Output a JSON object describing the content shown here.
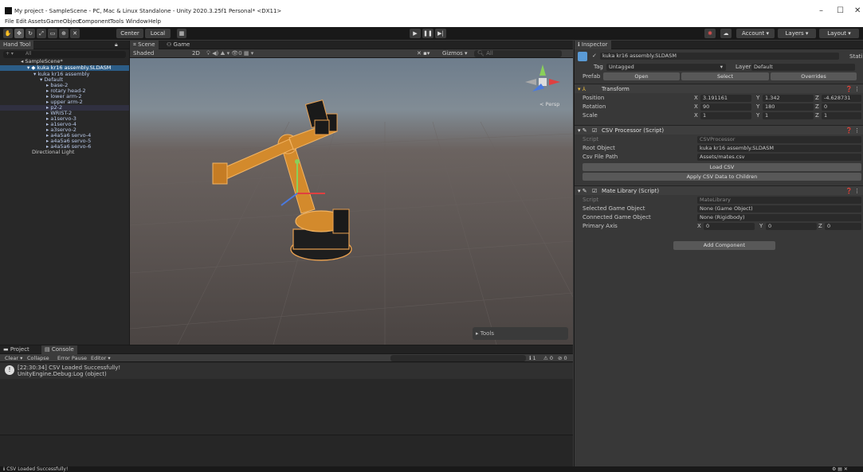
{
  "window": {
    "title": "My project - SampleScene - PC, Mac & Linux Standalone - Unity 2020.3.25f1 Personal* <DX11>",
    "controls": [
      "–",
      "☐",
      "✕"
    ]
  },
  "menu": [
    "File",
    "Edit",
    "Assets",
    "GameObject",
    "Component",
    "Tools",
    "Window",
    "Help"
  ],
  "toolbar": {
    "pivot": "Center",
    "space": "Local",
    "play": "▶",
    "pause": "❚❚",
    "step": "▶|",
    "account": "Account",
    "layers": "Layers",
    "layout": "Layout"
  },
  "hierarchy": {
    "tab": "Hand Tool",
    "search_placeholder": "All",
    "scene": "SampleScene*",
    "items": [
      "kuka kr16 assembly.SLDASM",
      "kuka kr16 assembly",
      "Default",
      "base-2",
      "rotary head-2",
      "lower arm-2",
      "upper arm-2",
      "p2-2",
      "WRIST-2",
      "a1servo-3",
      "a1servo-4",
      "a3servo-2",
      "a4a5a6 servo-4",
      "a4a5a6 servo-5",
      "a4a5a6 servo-6",
      "Directional Light"
    ]
  },
  "scene_view": {
    "tab_scene": "Scene",
    "tab_game": "Game",
    "shading": "Shaded",
    "mode_2d": "2D",
    "gizmos": "Gizmos",
    "search": "All",
    "persp": "< Persp",
    "tools": "Tools"
  },
  "inspector": {
    "tab": "Inspector",
    "object_name": "kuka kr16 assembly.SLDASM",
    "static": "Stati",
    "tag_label": "Tag",
    "tag": "Untagged",
    "layer_label": "Layer",
    "layer": "Default",
    "prefab_label": "Prefab",
    "prefab_open": "Open",
    "prefab_select": "Select",
    "prefab_overrides": "Overrides",
    "transform": {
      "title": "Transform",
      "position_label": "Position",
      "rotation_label": "Rotation",
      "scale_label": "Scale",
      "position": [
        "3.191161",
        "1.342",
        "-4.628731"
      ],
      "rotation": [
        "90",
        "180",
        "0"
      ],
      "scale": [
        "1",
        "1",
        "1"
      ]
    },
    "csv": {
      "title": "CSV Processor (Script)",
      "script_label": "Script",
      "script": "CSVProcessor",
      "root_label": "Root Object",
      "root": "kuka kr16 assembly.SLDASM",
      "path_label": "Csv File Path",
      "path": "Assets/mates.csv",
      "load_btn": "Load CSV",
      "apply_btn": "Apply CSV Data to Children"
    },
    "mate": {
      "title": "Mate Library (Script)",
      "script_label": "Script",
      "script": "MateLibrary",
      "selected_label": "Selected Game Object",
      "selected": "None (Game Object)",
      "connected_label": "Connected Game Object",
      "connected": "None (Rigidbody)",
      "axis_label": "Primary Axis",
      "axis": [
        "0",
        "0",
        "0"
      ]
    },
    "add_component": "Add Component"
  },
  "console": {
    "tab_project": "Project",
    "tab_console": "Console",
    "clear": "Clear",
    "collapse": "Collapse",
    "error_pause": "Error Pause",
    "editor": "Editor",
    "counts": [
      "1",
      "0",
      "0"
    ],
    "log_line1": "[22:30:34] CSV Loaded Successfully!",
    "log_line2": "UnityEngine.Debug:Log (object)"
  },
  "status": "CSV Loaded Successfully!"
}
